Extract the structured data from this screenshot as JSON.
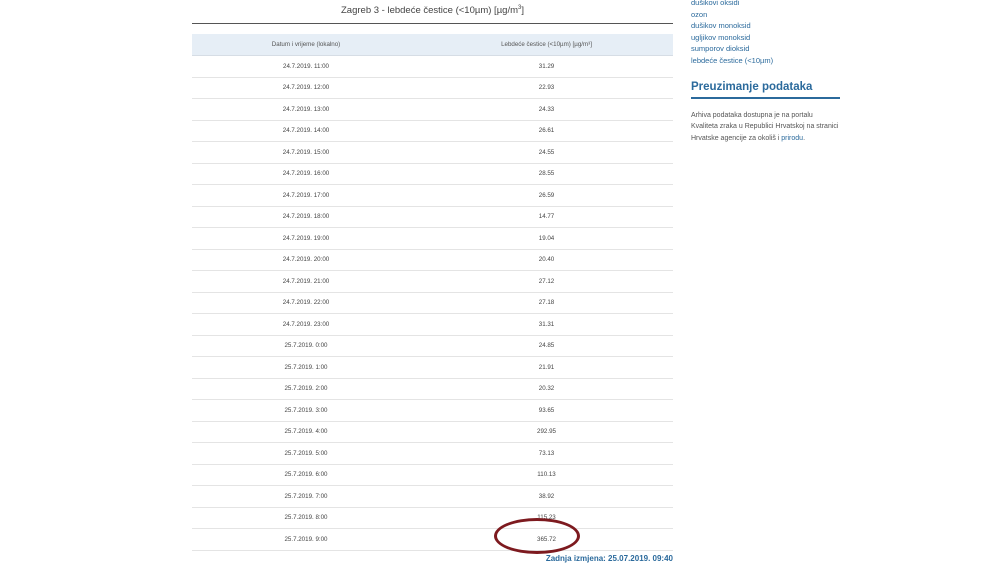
{
  "table": {
    "title": "Zagreb 3 - lebdeće čestice (<10µm) [µg/m",
    "title_unit_sup": "3",
    "title_suffix": "]",
    "headers": [
      "Datum i vrijeme (lokalno)",
      "Lebdeće čestice (<10µm) [µg/m³]"
    ],
    "rows": [
      [
        "24.7.2019. 11:00",
        "31.29"
      ],
      [
        "24.7.2019. 12:00",
        "22.93"
      ],
      [
        "24.7.2019. 13:00",
        "24.33"
      ],
      [
        "24.7.2019. 14:00",
        "26.61"
      ],
      [
        "24.7.2019. 15:00",
        "24.55"
      ],
      [
        "24.7.2019. 16:00",
        "28.55"
      ],
      [
        "24.7.2019. 17:00",
        "26.59"
      ],
      [
        "24.7.2019. 18:00",
        "14.77"
      ],
      [
        "24.7.2019. 19:00",
        "19.04"
      ],
      [
        "24.7.2019. 20:00",
        "20.40"
      ],
      [
        "24.7.2019. 21:00",
        "27.12"
      ],
      [
        "24.7.2019. 22:00",
        "27.18"
      ],
      [
        "24.7.2019. 23:00",
        "31.31"
      ],
      [
        "25.7.2019. 0:00",
        "24.85"
      ],
      [
        "25.7.2019. 1:00",
        "21.91"
      ],
      [
        "25.7.2019. 2:00",
        "20.32"
      ],
      [
        "25.7.2019. 3:00",
        "93.65"
      ],
      [
        "25.7.2019. 4:00",
        "292.95"
      ],
      [
        "25.7.2019. 5:00",
        "73.13"
      ],
      [
        "25.7.2019. 6:00",
        "110.13"
      ],
      [
        "25.7.2019. 7:00",
        "38.92"
      ],
      [
        "25.7.2019. 8:00",
        "115.23"
      ],
      [
        "25.7.2019. 9:00",
        "365.72"
      ]
    ],
    "last_updated": "Zadnja izmjena: 25.07.2019. 09:40",
    "highlight_color": "#7d1a1f"
  },
  "sidebar": {
    "pollutant_links": [
      "dušikovi oksidi",
      "ozon",
      "dušikov monoksid",
      "ugljikov monoksid",
      "sumporov dioksid",
      "lebdeće čestice (<10µm)"
    ],
    "download": {
      "heading": "Preuzimanje podataka",
      "text_before_link": "Arhiva podataka dostupna je na portalu Kvaliteta zraka u Republici Hrvatskoj na stranici Hrvatske agencije za okoliš i ",
      "link_text": "prirodu",
      "text_after_link": "."
    },
    "link_color": "#2b6a9c"
  }
}
